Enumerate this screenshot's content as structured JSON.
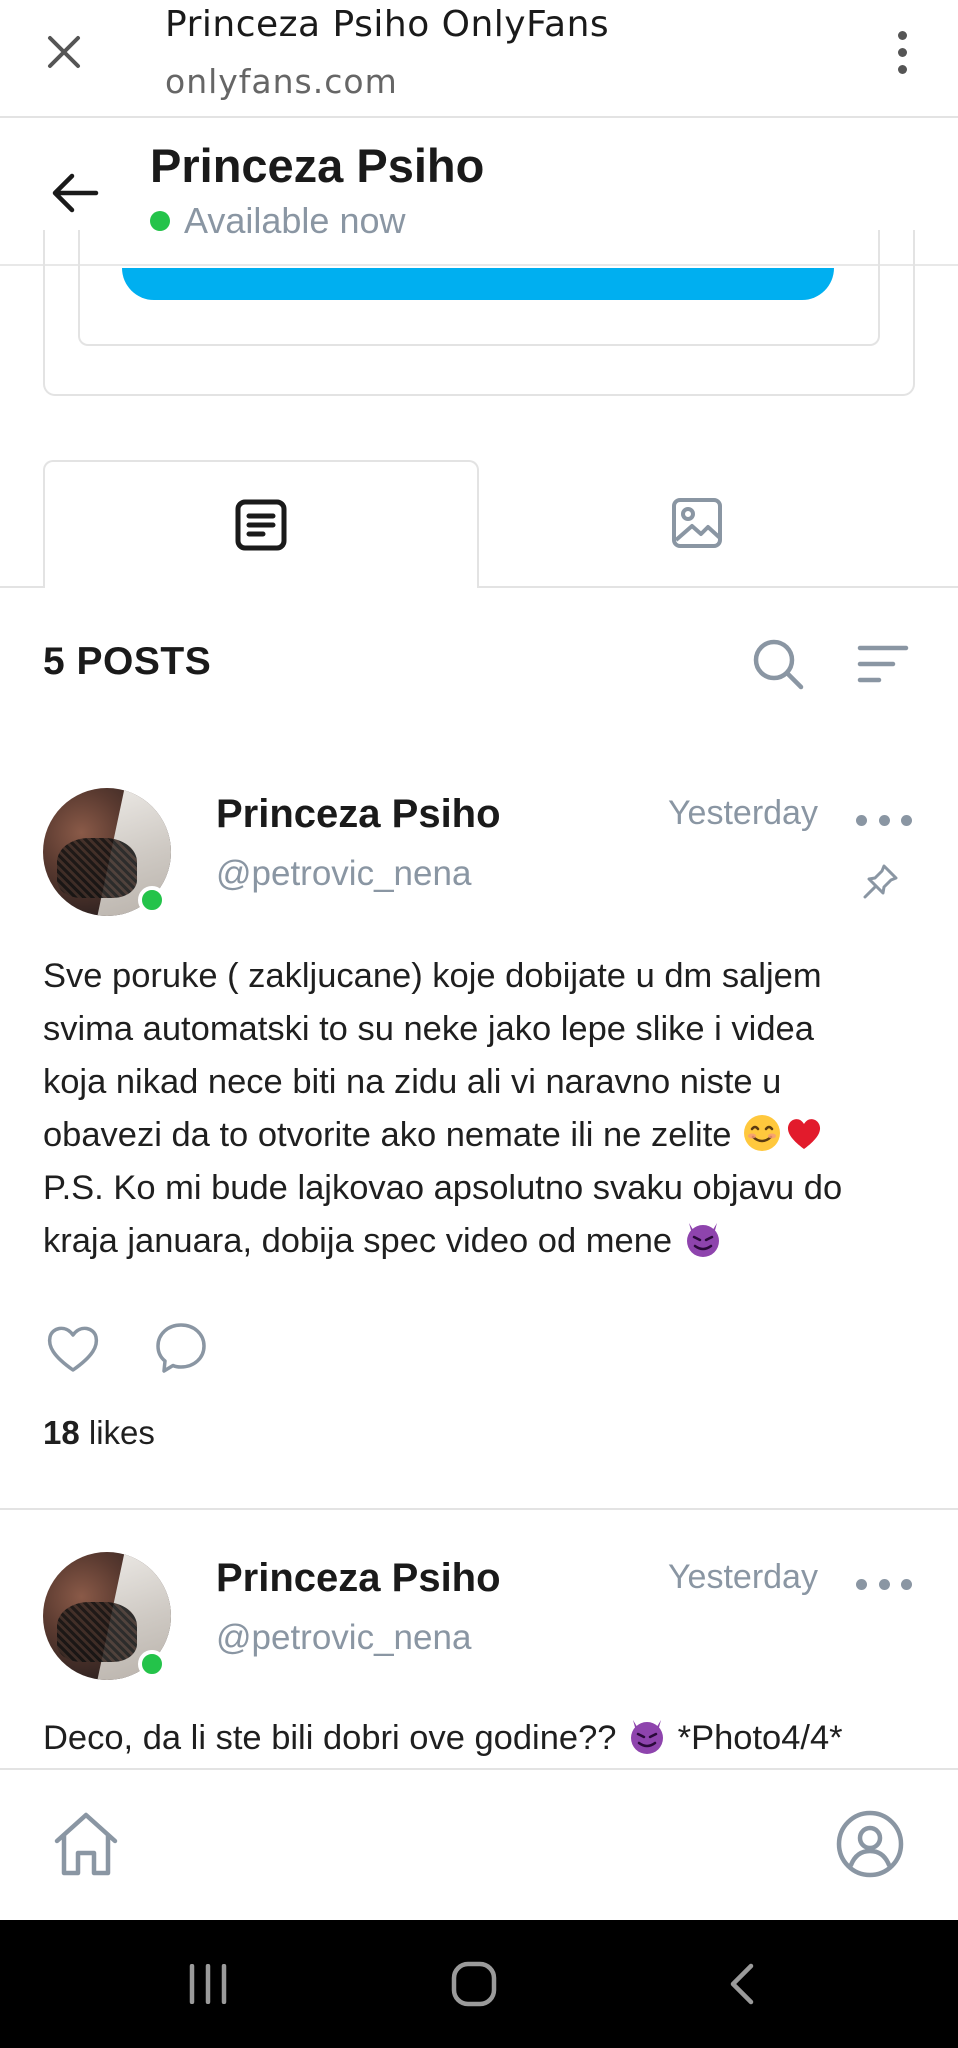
{
  "browser": {
    "title": "Princeza Psiho OnlyFans",
    "url": "onlyfans.com",
    "close_icon": "close-icon",
    "menu_icon": "more-vertical-icon"
  },
  "profile": {
    "name": "Princeza Psiho",
    "status": "Available now",
    "status_color": "#24c34a",
    "accent_color": "#00aff0"
  },
  "tabs": [
    {
      "icon": "posts-icon",
      "active": true
    },
    {
      "icon": "media-icon",
      "active": false
    }
  ],
  "posts_header": {
    "count_label": "5 POSTS",
    "search_icon": "search-icon",
    "sort_icon": "sort-icon"
  },
  "posts": [
    {
      "author": "Princeza Psiho",
      "handle": "@petrovic_nena",
      "time": "Yesterday",
      "pinned": true,
      "lines": [
        "Sve poruke ( zakljucane) koje dobijate u dm saljem",
        "svima automatski to su neke jako lepe slike i videa",
        "koja nikad nece biti na zidu ali vi naravno niste u",
        "obavezi da to otvorite ako nemate ili ne zelite",
        "P.S. Ko mi bude lajkovao apsolutno svaku objavu do",
        "kraja januara, dobija spec video od mene"
      ],
      "likes_count": "18",
      "likes_label": "likes"
    },
    {
      "author": "Princeza Psiho",
      "handle": "@petrovic_nena",
      "time": "Yesterday",
      "pinned": false,
      "text_before_emoji": "Deco, da li ste bili dobri ove godine??",
      "text_after_emoji": "*Photo4/4*"
    }
  ],
  "app_nav": {
    "home_icon": "home-icon",
    "profile_icon": "profile-icon"
  },
  "system_nav": {
    "recent_icon": "recent-apps-icon",
    "home_icon": "system-home-icon",
    "back_icon": "system-back-icon"
  }
}
